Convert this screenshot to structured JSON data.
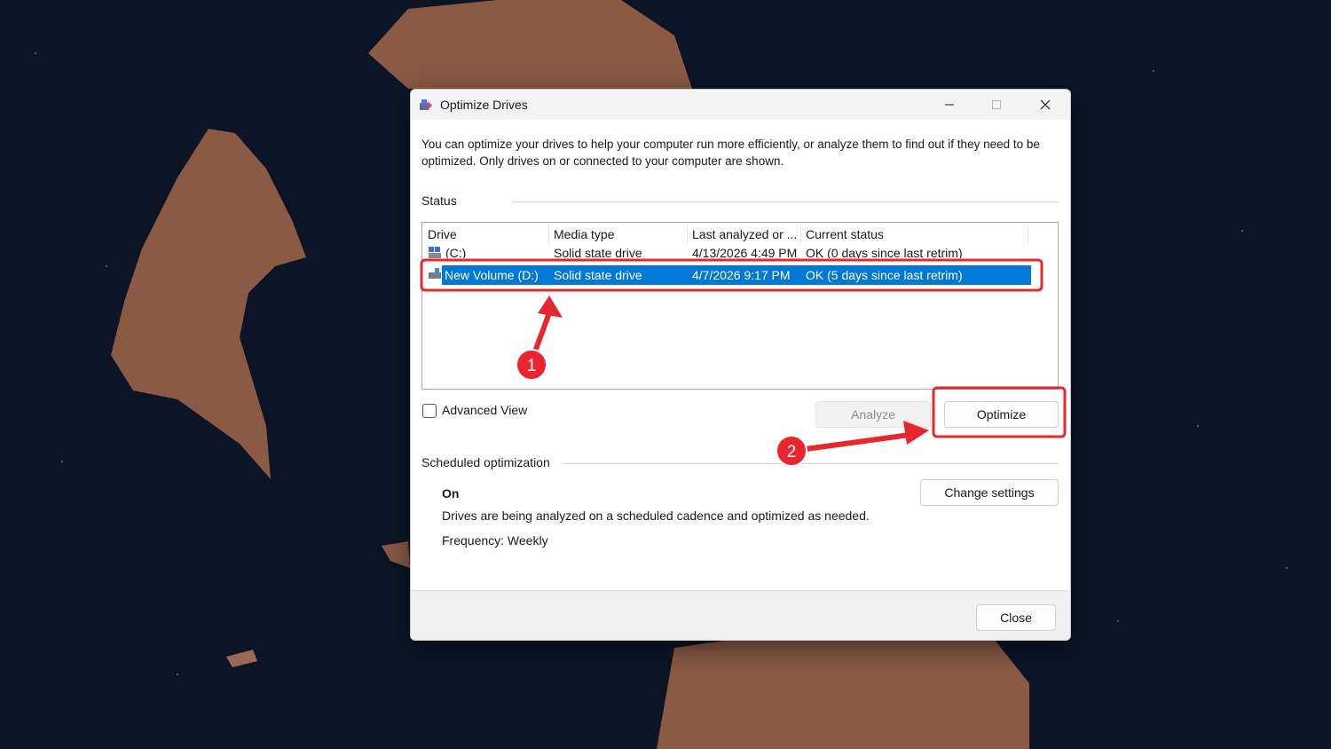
{
  "window": {
    "title": "Optimize Drives",
    "description": "You can optimize your drives to help your computer run more efficiently, or analyze them to find out if they need to be optimized. Only drives on or connected to your computer are shown."
  },
  "status": {
    "label": "Status",
    "columns": [
      "Drive",
      "Media type",
      "Last analyzed or ...",
      "Current status"
    ],
    "drives": [
      {
        "drive": "(C:)",
        "media": "Solid state drive",
        "last": "4/13/2026 4:49 PM",
        "status": "OK (0 days since last retrim)",
        "selected": false
      },
      {
        "drive": "New Volume (D:)",
        "media": "Solid state drive",
        "last": "4/7/2026 9:17 PM",
        "status": "OK (5 days since last retrim)",
        "selected": true
      }
    ]
  },
  "controls": {
    "advanced_view": "Advanced View",
    "analyze": "Analyze",
    "optimize": "Optimize"
  },
  "scheduled": {
    "label": "Scheduled optimization",
    "state": "On",
    "description": "Drives are being analyzed on a scheduled cadence and optimized as needed.",
    "frequency": "Frequency: Weekly",
    "change_settings": "Change settings"
  },
  "footer": {
    "close": "Close"
  },
  "annotations": {
    "step1": "1",
    "step2": "2",
    "accent_color": "#e8262c"
  }
}
